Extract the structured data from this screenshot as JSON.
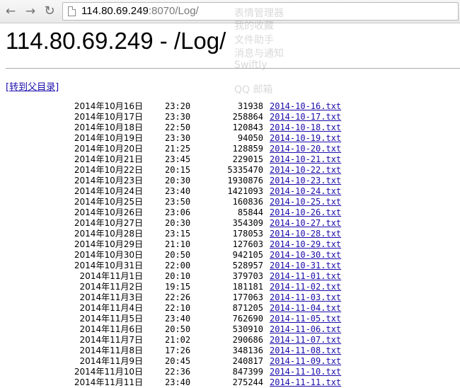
{
  "browser": {
    "back_icon": "back-arrow-icon",
    "forward_icon": "forward-arrow-icon",
    "reload_icon": "reload-icon",
    "url_host": "114.80.69.249",
    "url_rest": ":8070/Log/"
  },
  "overlay_menu": {
    "items": [
      "表情管理器",
      "我的收藏",
      "文件助手",
      "消息与通知",
      "Swiftly",
      "QQ 邮箱"
    ]
  },
  "page": {
    "title": "114.80.69.249 - /Log/",
    "parent_link": "[转到父目录]"
  },
  "files": [
    {
      "date": "2014年10月16日",
      "time": "23:20",
      "size": "31938",
      "name": "2014-10-16.txt"
    },
    {
      "date": "2014年10月17日",
      "time": "23:30",
      "size": "258864",
      "name": "2014-10-17.txt"
    },
    {
      "date": "2014年10月18日",
      "time": "22:50",
      "size": "120843",
      "name": "2014-10-18.txt"
    },
    {
      "date": "2014年10月19日",
      "time": "23:30",
      "size": "94050",
      "name": "2014-10-19.txt"
    },
    {
      "date": "2014年10月20日",
      "time": "21:25",
      "size": "128859",
      "name": "2014-10-20.txt"
    },
    {
      "date": "2014年10月21日",
      "time": "23:45",
      "size": "229015",
      "name": "2014-10-21.txt"
    },
    {
      "date": "2014年10月22日",
      "time": "20:15",
      "size": "5335470",
      "name": "2014-10-22.txt"
    },
    {
      "date": "2014年10月23日",
      "time": "20:30",
      "size": "1930876",
      "name": "2014-10-23.txt"
    },
    {
      "date": "2014年10月24日",
      "time": "23:40",
      "size": "1421093",
      "name": "2014-10-24.txt"
    },
    {
      "date": "2014年10月25日",
      "time": "23:50",
      "size": "160836",
      "name": "2014-10-25.txt"
    },
    {
      "date": "2014年10月26日",
      "time": "23:06",
      "size": "85844",
      "name": "2014-10-26.txt"
    },
    {
      "date": "2014年10月27日",
      "time": "20:30",
      "size": "354309",
      "name": "2014-10-27.txt"
    },
    {
      "date": "2014年10月28日",
      "time": "23:15",
      "size": "178053",
      "name": "2014-10-28.txt"
    },
    {
      "date": "2014年10月29日",
      "time": "21:10",
      "size": "127603",
      "name": "2014-10-29.txt"
    },
    {
      "date": "2014年10月30日",
      "time": "20:50",
      "size": "942105",
      "name": "2014-10-30.txt"
    },
    {
      "date": "2014年10月31日",
      "time": "22:00",
      "size": "528957",
      "name": "2014-10-31.txt"
    },
    {
      "date": "2014年11月1日",
      "time": "20:10",
      "size": "379703",
      "name": "2014-11-01.txt"
    },
    {
      "date": "2014年11月2日",
      "time": "19:15",
      "size": "181181",
      "name": "2014-11-02.txt"
    },
    {
      "date": "2014年11月3日",
      "time": "22:26",
      "size": "177063",
      "name": "2014-11-03.txt"
    },
    {
      "date": "2014年11月4日",
      "time": "22:10",
      "size": "871205",
      "name": "2014-11-04.txt"
    },
    {
      "date": "2014年11月5日",
      "time": "23:40",
      "size": "762690",
      "name": "2014-11-05.txt"
    },
    {
      "date": "2014年11月6日",
      "time": "20:50",
      "size": "530910",
      "name": "2014-11-06.txt"
    },
    {
      "date": "2014年11月7日",
      "time": "21:02",
      "size": "290686",
      "name": "2014-11-07.txt"
    },
    {
      "date": "2014年11月8日",
      "time": "17:26",
      "size": "348136",
      "name": "2014-11-08.txt"
    },
    {
      "date": "2014年11月9日",
      "time": "20:45",
      "size": "240817",
      "name": "2014-11-09.txt"
    },
    {
      "date": "2014年11月10日",
      "time": "22:36",
      "size": "847399",
      "name": "2014-11-10.txt"
    },
    {
      "date": "2014年11月11日",
      "time": "23:40",
      "size": "275244",
      "name": "2014-11-11.txt"
    }
  ]
}
